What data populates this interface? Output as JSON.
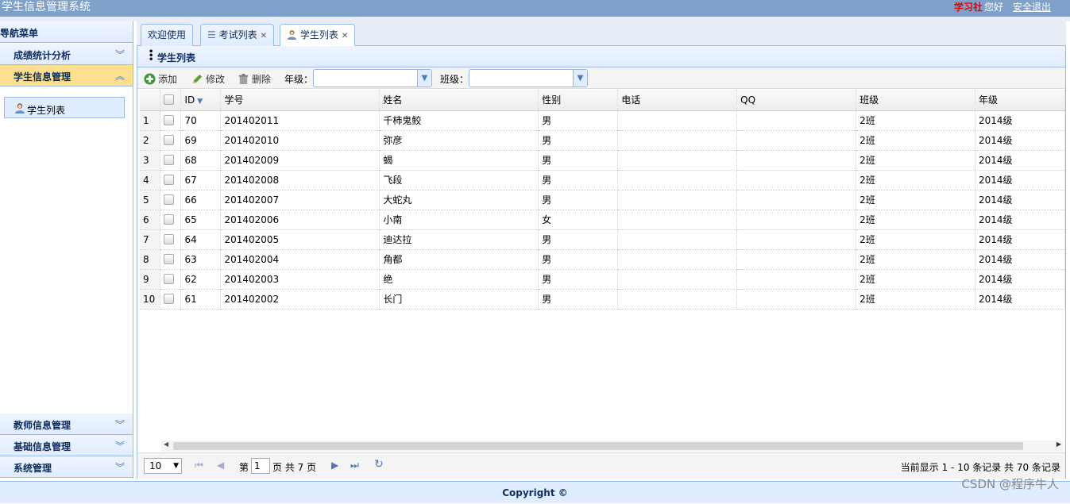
{
  "app": {
    "title": "学生信息管理系统",
    "user": "学习社",
    "greeting": "您好",
    "logout": "安全退出"
  },
  "sidebar": {
    "header": "导航菜单",
    "sections": [
      {
        "label": "成绩统计分析"
      },
      {
        "label": "学生信息管理"
      },
      {
        "label": "教师信息管理"
      },
      {
        "label": "基础信息管理"
      },
      {
        "label": "系统管理"
      }
    ],
    "active_item": "学生列表"
  },
  "tabs": [
    {
      "label": "欢迎使用"
    },
    {
      "label": "考试列表"
    },
    {
      "label": "学生列表"
    }
  ],
  "panel": {
    "title": "学生列表"
  },
  "toolbar": {
    "add": "添加",
    "edit": "修改",
    "delete": "删除",
    "grade_label": "年级：",
    "class_label": "班级："
  },
  "grid": {
    "columns": [
      "ID",
      "学号",
      "姓名",
      "性别",
      "电话",
      "QQ",
      "班级",
      "年级"
    ],
    "rows": [
      {
        "n": "1",
        "id": "70",
        "sno": "201402011",
        "name": "千柿鬼鲛",
        "sex": "男",
        "phone": "",
        "qq": "",
        "cls": "2班",
        "grade": "2014级"
      },
      {
        "n": "2",
        "id": "69",
        "sno": "201402010",
        "name": "弥彦",
        "sex": "男",
        "phone": "",
        "qq": "",
        "cls": "2班",
        "grade": "2014级"
      },
      {
        "n": "3",
        "id": "68",
        "sno": "201402009",
        "name": "蝎",
        "sex": "男",
        "phone": "",
        "qq": "",
        "cls": "2班",
        "grade": "2014级"
      },
      {
        "n": "4",
        "id": "67",
        "sno": "201402008",
        "name": "飞段",
        "sex": "男",
        "phone": "",
        "qq": "",
        "cls": "2班",
        "grade": "2014级"
      },
      {
        "n": "5",
        "id": "66",
        "sno": "201402007",
        "name": "大蛇丸",
        "sex": "男",
        "phone": "",
        "qq": "",
        "cls": "2班",
        "grade": "2014级"
      },
      {
        "n": "6",
        "id": "65",
        "sno": "201402006",
        "name": "小南",
        "sex": "女",
        "phone": "",
        "qq": "",
        "cls": "2班",
        "grade": "2014级"
      },
      {
        "n": "7",
        "id": "64",
        "sno": "201402005",
        "name": "迪达拉",
        "sex": "男",
        "phone": "",
        "qq": "",
        "cls": "2班",
        "grade": "2014级"
      },
      {
        "n": "8",
        "id": "63",
        "sno": "201402004",
        "name": "角都",
        "sex": "男",
        "phone": "",
        "qq": "",
        "cls": "2班",
        "grade": "2014级"
      },
      {
        "n": "9",
        "id": "62",
        "sno": "201402003",
        "name": "绝",
        "sex": "男",
        "phone": "",
        "qq": "",
        "cls": "2班",
        "grade": "2014级"
      },
      {
        "n": "10",
        "id": "61",
        "sno": "201402002",
        "name": "长门",
        "sex": "男",
        "phone": "",
        "qq": "",
        "cls": "2班",
        "grade": "2014级"
      }
    ]
  },
  "pager": {
    "page_size": "10",
    "page_prefix": "第",
    "page_value": "1",
    "page_suffix": "页 共 7 页",
    "info": "当前显示 1 - 10 条记录 共 70 条记录"
  },
  "footer": {
    "copyright": "Copyright ©"
  },
  "watermark": "CSDN @程序牛人",
  "icons": {
    "collapse": "double-chevron-left-icon",
    "expand": "double-chevron-down-icon",
    "active_expand": "double-chevron-up-icon"
  }
}
